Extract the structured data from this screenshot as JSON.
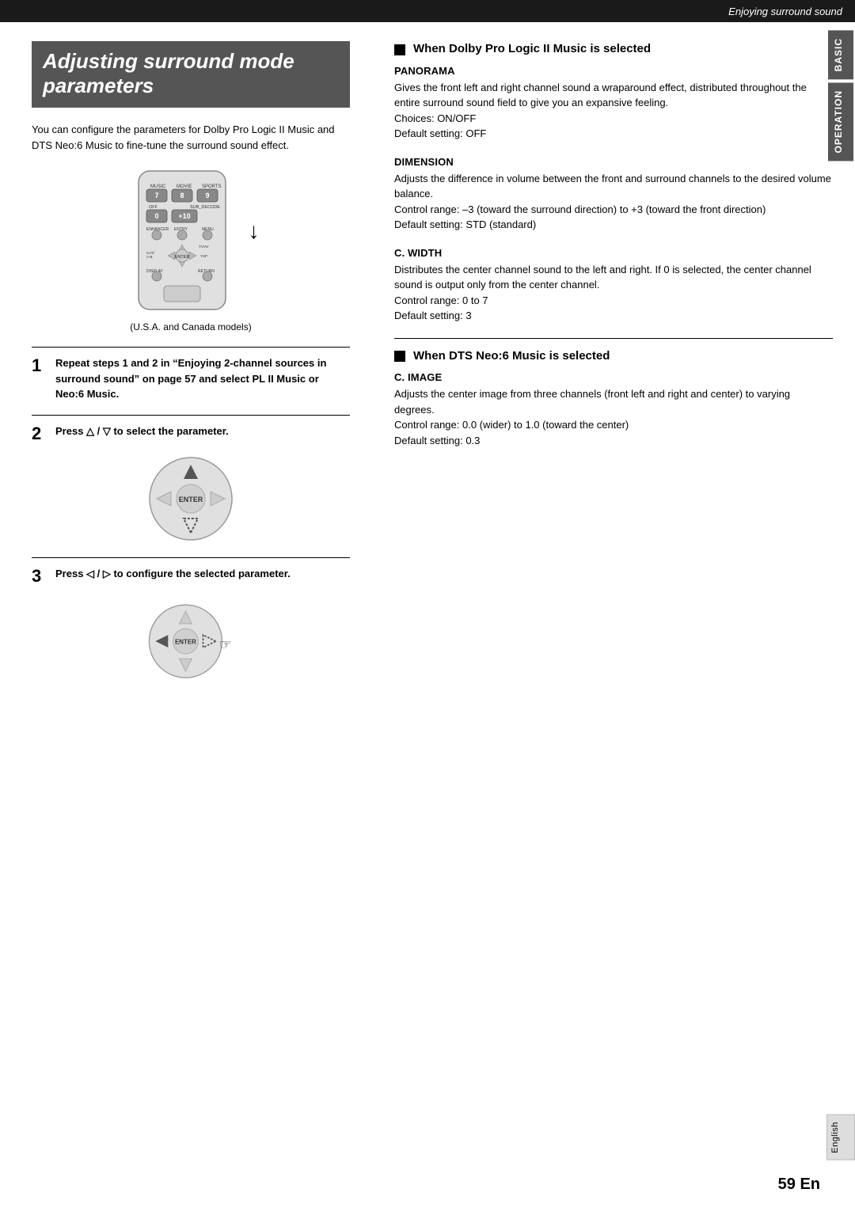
{
  "topBar": {
    "title": "Enjoying surround sound"
  },
  "titleBox": {
    "line1": "Adjusting surround mode",
    "line2": "parameters"
  },
  "introText": "You can configure the parameters for Dolby Pro Logic II Music and DTS Neo:6 Music to fine-tune the surround sound effect.",
  "remoteCaption": "(U.S.A. and Canada models)",
  "steps": [
    {
      "num": "1",
      "text": "Repeat steps 1 and 2 in “Enjoying 2-channel sources in surround sound” on page 57 and select PL II Music or Neo:6 Music.",
      "showNav": false
    },
    {
      "num": "2",
      "text": "Press △ / ▽ to select the parameter.",
      "showNav": true,
      "navType": "updown"
    },
    {
      "num": "3",
      "text": "Press ◁ / ▷ to configure the selected parameter.",
      "showNav": true,
      "navType": "leftright"
    }
  ],
  "rightSections": [
    {
      "id": "dolby",
      "header": "When Dolby Pro Logic II Music is selected",
      "subSections": [
        {
          "title": "PANORAMA",
          "body": "Gives the front left and right channel sound a wraparound effect, distributed throughout the entire surround sound field to give you an expansive feeling.\nChoices: ON/OFF\nDefault setting: OFF"
        },
        {
          "title": "DIMENSION",
          "body": "Adjusts the difference in volume between the front and surround channels to the desired volume balance.\nControl range: –3 (toward the surround direction) to +3 (toward the front direction)\nDefault setting: STD (standard)"
        },
        {
          "title": "C. WIDTH",
          "body": "Distributes the center channel sound to the left and right. If 0 is selected, the center channel sound is output only from the center channel.\nControl range: 0 to 7\nDefault setting: 3"
        }
      ]
    },
    {
      "id": "dts",
      "header": "When DTS Neo:6 Music is selected",
      "subSections": [
        {
          "title": "C. IMAGE",
          "body": "Adjusts the center image from three channels (front left and right and center) to varying degrees.\nControl range: 0.0 (wider) to 1.0 (toward the center)\nDefault setting: 0.3"
        }
      ]
    }
  ],
  "sidebar": {
    "basicLabel": "BASIC",
    "operationLabel": "OPERATION"
  },
  "langTab": "English",
  "pageNumber": "59 En"
}
